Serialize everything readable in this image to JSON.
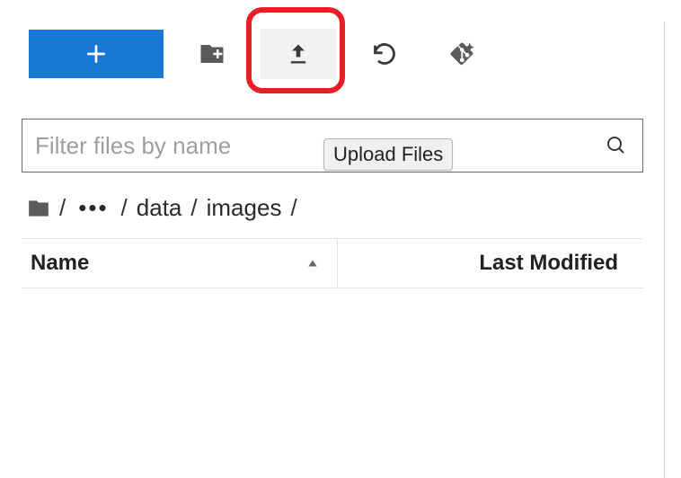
{
  "toolbar": {
    "upload_tooltip": "Upload Files"
  },
  "filter": {
    "placeholder": "Filter files by name"
  },
  "breadcrumb": {
    "segments": [
      "data",
      "images"
    ]
  },
  "columns": {
    "name": "Name",
    "modified": "Last Modified"
  }
}
